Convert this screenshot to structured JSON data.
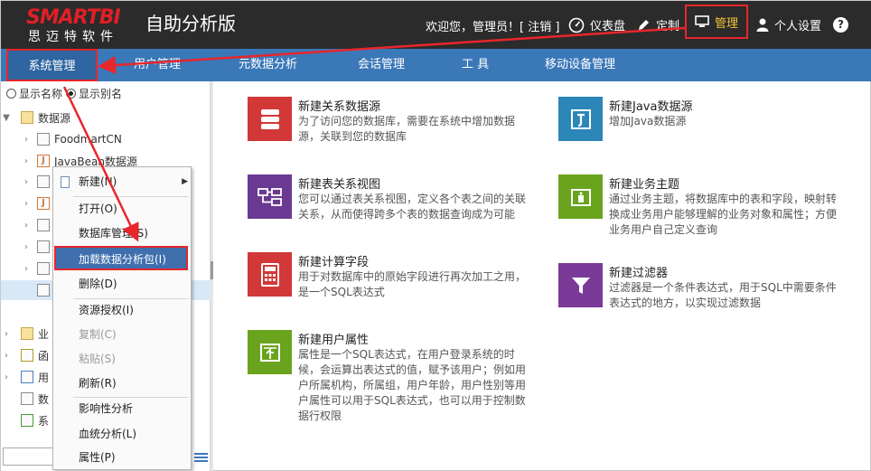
{
  "header": {
    "logo_text": "SMARTBI",
    "logo_sub": "思迈特软件",
    "app_title": "自助分析版",
    "welcome": "欢迎您，管理员！[ 注销 ]",
    "nav": {
      "dashboard": "仪表盘",
      "custom": "定制",
      "manage": "管理",
      "personal": "个人设置"
    },
    "help": "?"
  },
  "menubar": {
    "items": [
      "系统管理",
      "用户管理",
      "元数据分析",
      "会话管理",
      "工 具",
      "移动设备管理"
    ]
  },
  "left": {
    "radio_name": "显示名称",
    "radio_alias": "显示别名",
    "tree": {
      "root": "数据源",
      "child1": "FoodmartCN",
      "child2": "JavaBean数据源",
      "g1": "业",
      "g2": "函",
      "g3": "用",
      "g4": "数",
      "g5": "系"
    }
  },
  "context_menu": {
    "new": "新建(N)",
    "open": "打开(O)",
    "db_manage": "数据库管理(S)",
    "load_pkg": "加载数据分析包(I)",
    "delete": "删除(D)",
    "grant": "资源授权(I)",
    "copy": "复制(C)",
    "paste": "粘贴(S)",
    "refresh": "刷新(R)",
    "impact": "影响性分析",
    "lineage": "血统分析(L)",
    "props": "属性(P)"
  },
  "tiles": {
    "t1": {
      "title": "新建关系数据源",
      "desc": "为了访问您的数据库，需要在系统中增加数据源，关联到您的数据库",
      "color": "#d23838"
    },
    "t2": {
      "title": "新建Java数据源",
      "desc": "增加Java数据源",
      "color": "#2c86b8"
    },
    "t3": {
      "title": "新建表关系视图",
      "desc": "您可以通过表关系视图，定义各个表之间的关联关系，从而使得跨多个表的数据查询成为可能",
      "color": "#6a3a93"
    },
    "t4": {
      "title": "新建业务主题",
      "desc": "通过业务主题，将数据库中的表和字段，映射转换成业务用户能够理解的业务对象和属性；方便业务用户自己定义查询",
      "color": "#6aa41e"
    },
    "t5": {
      "title": "新建计算字段",
      "desc": "用于对数据库中的原始字段进行再次加工之用，是一个SQL表达式",
      "color": "#d23838"
    },
    "t6": {
      "title": "新建过滤器",
      "desc": "过滤器是一个条件表达式，用于SQL中需要条件表达式的地方，以实现过滤数据",
      "color": "#7a3a97"
    },
    "t7": {
      "title": "新建用户属性",
      "desc": "属性是一个SQL表达式，在用户登录系统的时候，会运算出表达式的值，赋予该用户；例如用户所属机构，所属组，用户年龄，用户性别等用户属性可以用于SQL表达式，也可以用于控制数据行权限",
      "color": "#6aa41e"
    }
  },
  "colors": {
    "header_bg": "#2b2b2b",
    "menubar_bg": "#3b78b8",
    "highlight_red": "#e8262c",
    "logo_red": "#e01f27",
    "manage_yellow": "#f2c33b"
  }
}
